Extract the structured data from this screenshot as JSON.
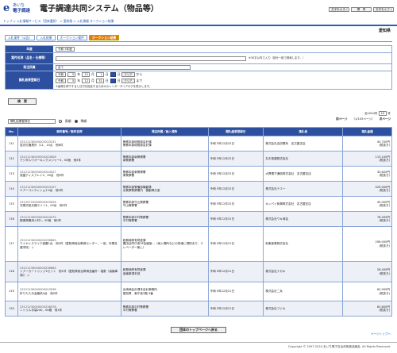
{
  "header": {
    "logo_mark": "e",
    "logo_line1": "あいち",
    "logo_line2": "電子調達",
    "system_title": "電子調達共同システム（物品等）",
    "buttons": [
      "文字を大きく",
      "標　準",
      "文字を小さく"
    ],
    "buttons2": [
      "",
      ""
    ]
  },
  "breadcrumb": "トップ > 入札情報サービス（団体選択） > 愛知県 > 入札情報 オークション結果",
  "prefecture": "愛知県",
  "tabs": [
    "入札案件（公告）",
    "入札結果",
    "オークション案件",
    "オークション結果"
  ],
  "form": {
    "year_label": "年度",
    "year_value": "令和 5年度",
    "case_label": "案件名称（品名・仕様等）",
    "case_note": "※30字以内で入力（部分一致で検索します。）",
    "dept_label": "発注所属",
    "dept_value": "全て",
    "open_label": "開札結果登録日",
    "from_era": "令和",
    "from_y": "5",
    "from_m": "12",
    "from_d": "1",
    "to_era": "令和",
    "to_y": "5",
    "to_m": "12",
    "to_d": "31",
    "weekday1": "日",
    "weekday2": "日",
    "unit_year": "年",
    "unit_month": "月",
    "unit_day": "日",
    "clear": "クリア",
    "from_suffix": "から",
    "to_suffix": "まで",
    "date_note": "※画像を押下すると日付を指定するためのカレンダーダイアログを表示します。",
    "search_button": "検　索"
  },
  "results": {
    "sort_value": "開札結果登録日",
    "sort_asc": "昇順",
    "sort_desc": "降順",
    "total": "全1044件",
    "per_page": "10",
    "per_page_unit": "件",
    "prev": "前ページ",
    "page_info": "（1/105ページ）",
    "next": "次ページ"
  },
  "table": {
    "headers": [
      "No.",
      "案件番号／案件名称",
      "発注所属／納入場所",
      "開札結果登録日",
      "落札者",
      "落札金額"
    ],
    "rows": [
      {
        "no": "111",
        "id": "23121230000000233151",
        "name": "蛍光灯器具外（11，10点　他8件",
        "dept": "警察本部総務部会計課",
        "place": "警察本部総務部会計課",
        "date": "令和 5年12月22日",
        "winner": "株式会社吉田電気　名古屋支店",
        "amount": "40,700円",
        "tax": "(税抜き)"
      },
      {
        "no": "112",
        "id": "23121230000000243828",
        "name": "デジタルウオーキングメジャー3，00個　他3件",
        "dept": "警察本部南警察署",
        "place": "南警察署",
        "date": "令和 5年12月22日",
        "winner": "丸中島建株式会社",
        "amount": "113,100円",
        "tax": "(税抜き)"
      },
      {
        "no": "113",
        "id": "23121230000000244027",
        "name": "液晶ディスプレイ2，00台　他0件",
        "dept": "警察本部東警察署",
        "place": "東警察署",
        "date": "令和 5年12月22日",
        "winner": "大興電子通信株式会社　名古屋支店",
        "amount": "30,620円",
        "tax": "(税抜き)"
      },
      {
        "no": "114",
        "id": "23121230000000244157",
        "name": "エアーコンディショナ4台　他0件",
        "dept": "警察本部警備部機動隊",
        "place": "北警察警察署内　機動隊分室",
        "date": "令和 5年12月22日",
        "winner": "株式会社テユー",
        "amount": "529,000円",
        "tax": "(税抜き)"
      },
      {
        "no": "115",
        "id": "23120722000000243026",
        "name": "充電式投光器ライト1，00台　他0件",
        "dept": "警察本部守山警察署",
        "place": "守山警察署",
        "date": "令和 5年12月22日",
        "winner": "キンパイ商事株式会社　名古屋支店",
        "amount": "45,000円",
        "tax": "(税抜き)"
      },
      {
        "no": "116",
        "id": "23121230000000244075",
        "name": "郵便書籍用人材1，00個　他0件",
        "dept": "警察本部中村警察署",
        "place": "中村警察署",
        "date": "令和 5年12月22日",
        "winner": "株式会社ワキ商会",
        "amount": "78,500円",
        "tax": "(税抜き)"
      },
      {
        "no": "117",
        "id": "23121230000000236663",
        "name": "ワイヤレスマイク装置1台　他0件（愛知県総合教育センター、一宮、本郷支援学校）ン",
        "dept": "総務局県有財産課",
        "place": "豊田合同庁舎3F会議室…（納入場所などの詳細に規則あり、エレベーター無し）",
        "date": "令和 5年12月21日",
        "winner": "前東産業株式会社",
        "amount": "206,000円",
        "tax": "(税抜き)"
      },
      {
        "no": "118",
        "id": "23121230000000236663",
        "name": "トナーカートリッジ1セット　他1件（愛知県総合教育品番外・複数（協議事項））ン",
        "dept": "総務局県有財産課",
        "place": "協議事項本部",
        "date": "令和 5年12月21日",
        "winner": "株式会社ナガキ",
        "amount": "26,400円",
        "tax": "(税抜き)"
      },
      {
        "no": "119",
        "id": "23121230000000243938",
        "name": "折りたたみ会議机4台　他0件",
        "dept": "出納局会計課本会計事務所",
        "place": "愛知県　東庁舎3階 3番",
        "date": "令和 5年12月21日",
        "winner": "株式会社二兵",
        "amount": "62,900円",
        "tax": "(税抜き)"
      },
      {
        "no": "120",
        "id": "23121230000000236078",
        "name": "ニトリル手袋240，00箱　他1件",
        "dept": "警察本部中村警察署",
        "place": "中村警察署",
        "date": "令和 5年12月21日",
        "winner": "株式会社フジカ",
        "amount": "82,800円",
        "tax": "(税抜き)"
      }
    ]
  },
  "bottom_button": "団体のトップページへ戻る",
  "page_top": "ページトップへ",
  "copyright": "Copyright © 2007-2024 あいち電子自治体推進協議会. All Rights Reserved."
}
